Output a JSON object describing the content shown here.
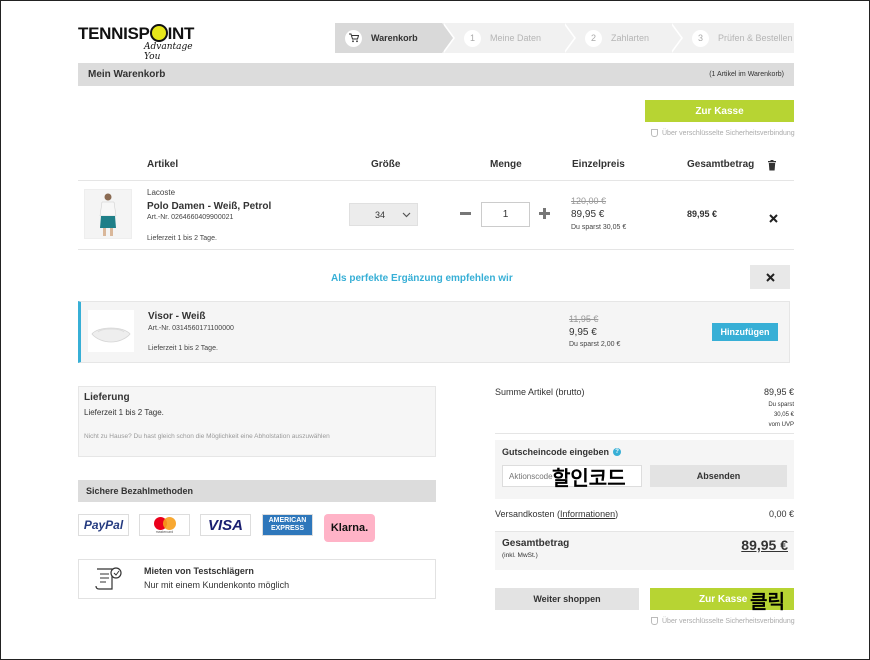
{
  "logo": {
    "part1": "TENNIS",
    "part2": "P",
    "part3": "INT",
    "tagline": "Advantage You"
  },
  "steps": [
    {
      "num": "",
      "label": "Warenkorb",
      "active": true
    },
    {
      "num": "1",
      "label": "Meine Daten",
      "active": false
    },
    {
      "num": "2",
      "label": "Zahlarten",
      "active": false
    },
    {
      "num": "3",
      "label": "Prüfen & Bestellen",
      "active": false
    }
  ],
  "cart_header": {
    "title": "Mein Warenkorb",
    "count": "(1 Artikel im Warenkorb)"
  },
  "checkout_button": "Zur Kasse",
  "secure_text": "Über verschlüsselte Sicherheitsverbindung",
  "columns": {
    "article": "Artikel",
    "size": "Größe",
    "qty": "Menge",
    "unit": "Einzelpreis",
    "total": "Gesamtbetrag"
  },
  "item": {
    "brand": "Lacoste",
    "name": "Polo Damen - Weiß, Petrol",
    "artnr": "Art.-Nr. 0264660409900021",
    "delivery": "Lieferzeit 1 bis 2 Tage.",
    "size": "34",
    "qty": "1",
    "old_price": "120,00 €",
    "price": "89,95 €",
    "savings": "Du sparst 30,05 €",
    "total": "89,95 €"
  },
  "recommend": {
    "heading": "Als perfekte Ergänzung empfehlen wir",
    "name": "Visor - Weiß",
    "artnr": "Art.-Nr. 0314560171100000",
    "delivery": "Lieferzeit 1 bis 2 Tage.",
    "old_price": "11,95 €",
    "price": "9,95 €",
    "savings": "Du sparst 2,00 €",
    "add_button": "Hinzufügen"
  },
  "delivery": {
    "title": "Lieferung",
    "time": "Lieferzeit 1 bis 2 Tage.",
    "note": "Nicht zu Hause? Du hast gleich schon die Möglichkeit eine Abholstation auszuwählen"
  },
  "payment": {
    "title": "Sichere Bezahlmethoden",
    "methods": [
      "PayPal",
      "mastercard",
      "VISA",
      "AMERICAN",
      "EXPRESS",
      "Klarna."
    ]
  },
  "rent": {
    "title": "Mieten von Testschlägern",
    "text": "Nur mit einem Kundenkonto möglich"
  },
  "summary": {
    "subtotal_label": "Summe Artikel (brutto)",
    "subtotal": "89,95 €",
    "saved_1": "Du sparst",
    "saved_2": "30,05 €",
    "saved_3": "vom UVP",
    "coupon_label": "Gutscheincode eingeben",
    "coupon_placeholder": "Aktionscode",
    "coupon_button": "Absenden",
    "shipping_label": "Versandkosten (",
    "shipping_link": "Informationen",
    "shipping_label_end": ")",
    "shipping": "0,00 €",
    "total_label": "Gesamtbetrag",
    "total_sub": "(inkl. MwSt.)",
    "total": "89,95 €"
  },
  "continue_button": "Weiter shoppen",
  "annotations": {
    "coupon_korean": "할인코드",
    "click_korean": "클릭"
  },
  "colors": {
    "accent_green": "#b7d433",
    "accent_blue": "#37afd6",
    "klarna_pink": "#ffb3c7"
  }
}
